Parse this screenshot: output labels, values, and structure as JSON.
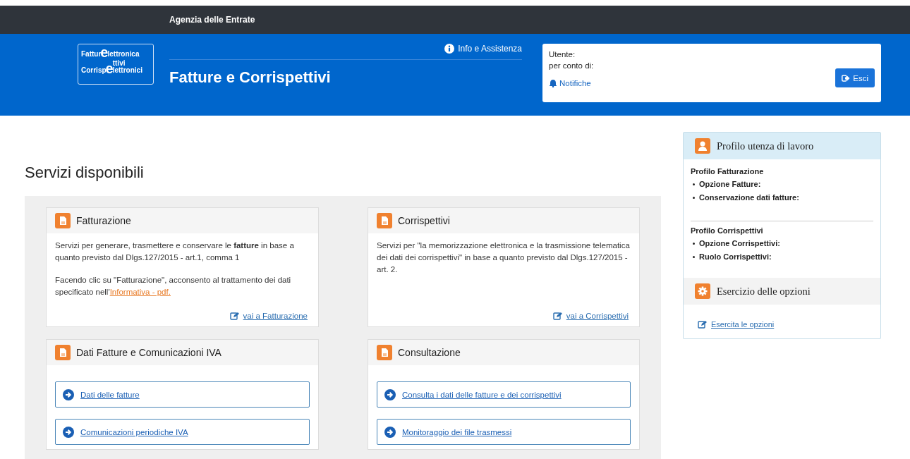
{
  "top_bar": {
    "title": "Agenzia delle Entrate"
  },
  "header": {
    "logo": [
      {
        "prefix": "Fattur",
        "mark": "e",
        "suffix": "lettronica"
      },
      {
        "prefix": "Corrisp",
        "mark": "e",
        "top": "ttivi",
        "suffix": "lettronici"
      }
    ],
    "title": "Fatture e Corrispettivi",
    "info_link": "Info e Assistenza"
  },
  "user_box": {
    "lines": [
      "Utente:",
      "per conto di:"
    ],
    "notifications": "Notifiche",
    "logout_button": "Esci"
  },
  "page_title": "Servizi disponibili",
  "cards": [
    {
      "kind": "description",
      "title": "Fatturazione",
      "paragraphs": [
        {
          "text": "Servizi per generare, trasmettere e conservare le **fatture** in base a quanto previsto dal Dlgs.127/2015 - art.1, comma 1"
        },
        {
          "text": "Facendo clic su \"Fatturazione\", acconsento al trattamento dei dati specificato nell'",
          "link": "Informativa - pdf."
        }
      ],
      "action": "vai a Fatturazione"
    },
    {
      "kind": "description",
      "title": "Corrispettivi",
      "paragraphs": [
        {
          "text": "Servizi per \"la memorizzazione elettronica e la trasmissione telematica dei dati dei corrispettivi\" in base a quanto previsto dal Dlgs.127/2015 - art. 2."
        }
      ],
      "action": "vai a Corrispettivi"
    },
    {
      "kind": "links",
      "title": "Dati Fatture e Comunicazioni IVA",
      "links": [
        "Dati delle fatture",
        "Comunicazioni periodiche IVA"
      ]
    },
    {
      "kind": "links",
      "title": "Consultazione",
      "links": [
        "Consulta i dati delle fatture e dei corrispettivi",
        "Monitoraggio dei file trasmessi"
      ]
    }
  ],
  "sidebar": [
    {
      "kind": "profile",
      "title": "Profilo utenza di lavoro",
      "groups": [
        {
          "title": "Profilo Fatturazione",
          "items": [
            "Opzione Fatture:",
            "Conservazione dati fatture:"
          ]
        },
        {
          "title": "Profilo Corrispettivi",
          "items": [
            "Opzione Corrispettivi:",
            "Ruolo Corrispettivi:"
          ]
        }
      ]
    },
    {
      "kind": "options",
      "title": "Esercizio delle opzioni",
      "link": "Esercita le opzioni"
    }
  ]
}
